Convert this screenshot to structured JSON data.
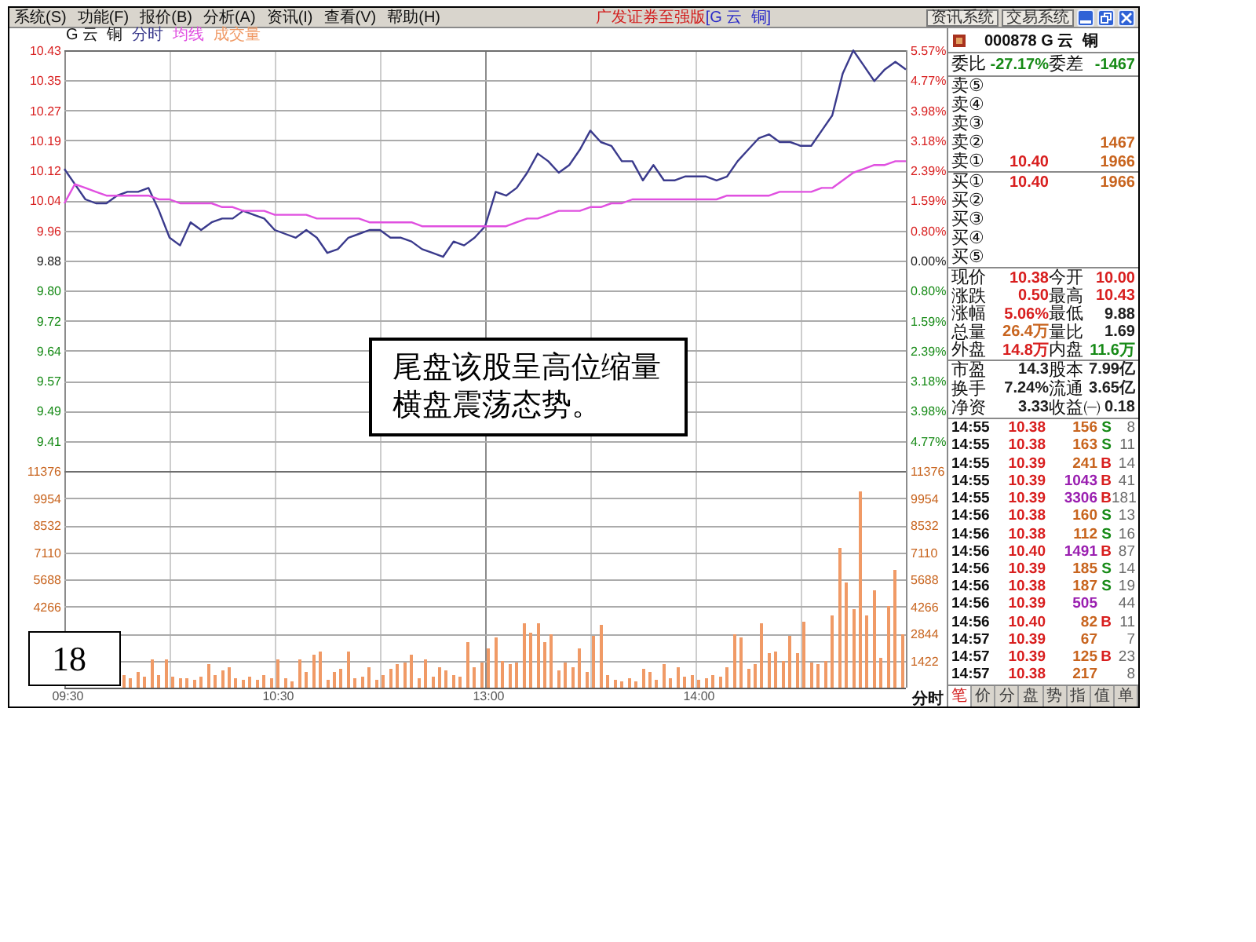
{
  "menu_bar": {
    "items": [
      "系统(S)",
      "功能(F)",
      "报价(B)",
      "分析(A)",
      "资讯(I)",
      "查看(V)",
      "帮助(H)"
    ],
    "app_title": "广发证券至强版",
    "stock_title": "[G 云  铜]",
    "system_buttons": [
      "资讯系统",
      "交易系统"
    ]
  },
  "price_chart": {
    "chart_data": {
      "type": "line",
      "title": "G 云  铜",
      "grid": true,
      "ylim": [
        9.4083,
        10.4303
      ],
      "yticks": [
        {
          "value": 10.4303,
          "label": "10.43"
        },
        {
          "value": 10.3517,
          "label": "10.35"
        },
        {
          "value": 10.2731,
          "label": "10.27"
        },
        {
          "value": 10.1945,
          "label": "10.19"
        },
        {
          "value": 10.1159,
          "label": "10.12"
        },
        {
          "value": 10.0372,
          "label": "10.04"
        },
        {
          "value": 9.9586,
          "label": "9.96"
        },
        {
          "value": 9.88,
          "label": "9.88"
        },
        {
          "value": 9.8014,
          "label": "9.80"
        },
        {
          "value": 9.7228,
          "label": "9.72"
        },
        {
          "value": 9.6441,
          "label": "9.64"
        },
        {
          "value": 9.5655,
          "label": "9.57"
        },
        {
          "value": 9.4869,
          "label": "9.49"
        },
        {
          "value": 9.4083,
          "label": "9.41"
        }
      ],
      "series": [
        {
          "name": "分时",
          "color": "#3a3a8c",
          "values": [
            10.12,
            10.08,
            10.04,
            10.03,
            10.03,
            10.05,
            10.06,
            10.06,
            10.07,
            10.01,
            9.94,
            9.92,
            9.98,
            9.96,
            9.98,
            9.99,
            9.99,
            10.01,
            10.0,
            9.99,
            9.96,
            9.95,
            9.94,
            9.96,
            9.94,
            9.9,
            9.91,
            9.94,
            9.95,
            9.96,
            9.96,
            9.94,
            9.94,
            9.93,
            9.91,
            9.9,
            9.89,
            9.93,
            9.92,
            9.94,
            9.97,
            10.06,
            10.05,
            10.07,
            10.11,
            10.16,
            10.14,
            10.11,
            10.13,
            10.17,
            10.22,
            10.19,
            10.18,
            10.14,
            10.14,
            10.09,
            10.13,
            10.09,
            10.09,
            10.1,
            10.1,
            10.1,
            10.09,
            10.1,
            10.14,
            10.17,
            10.2,
            10.21,
            10.19,
            10.19,
            10.18,
            10.18,
            10.22,
            10.26,
            10.37,
            10.43,
            10.39,
            10.35,
            10.38,
            10.4,
            10.38
          ]
        },
        {
          "name": "均线",
          "color": "#e050e0",
          "values": [
            10.03,
            10.08,
            10.07,
            10.06,
            10.05,
            10.05,
            10.05,
            10.05,
            10.05,
            10.04,
            10.04,
            10.03,
            10.03,
            10.03,
            10.03,
            10.02,
            10.02,
            10.01,
            10.01,
            10.01,
            10.0,
            10.0,
            10.0,
            10.0,
            9.99,
            9.99,
            9.99,
            9.99,
            9.99,
            9.98,
            9.98,
            9.98,
            9.98,
            9.98,
            9.97,
            9.97,
            9.97,
            9.97,
            9.97,
            9.97,
            9.97,
            9.97,
            9.97,
            9.98,
            9.99,
            9.99,
            10.0,
            10.01,
            10.01,
            10.01,
            10.02,
            10.02,
            10.03,
            10.03,
            10.04,
            10.04,
            10.04,
            10.04,
            10.04,
            10.04,
            10.04,
            10.04,
            10.04,
            10.05,
            10.05,
            10.05,
            10.05,
            10.05,
            10.06,
            10.06,
            10.06,
            10.06,
            10.07,
            10.07,
            10.09,
            10.11,
            10.12,
            10.13,
            10.13,
            10.14,
            10.14
          ]
        }
      ]
    },
    "percent_labels": [
      "5.57%",
      "4.77%",
      "3.98%",
      "3.18%",
      "2.39%",
      "1.59%",
      "0.80%",
      "0.00%",
      "0.80%",
      "1.59%",
      "2.39%",
      "3.18%",
      "3.98%",
      "4.77%"
    ]
  },
  "volume_chart": {
    "chart_data": {
      "type": "bar",
      "grid": true,
      "categories": [
        "09:30",
        null,
        null,
        null,
        null,
        null,
        null,
        null,
        null,
        null,
        null,
        null,
        null,
        null,
        null,
        null,
        null,
        null,
        null,
        null,
        null,
        null,
        null,
        null,
        null,
        null,
        null,
        null,
        null,
        null,
        "10:30",
        null,
        null,
        null,
        null,
        null,
        null,
        null,
        null,
        null,
        null,
        null,
        null,
        null,
        null,
        null,
        null,
        null,
        null,
        null,
        null,
        null,
        null,
        null,
        null,
        null,
        null,
        null,
        null,
        null,
        "13:00",
        null,
        null,
        null,
        null,
        null,
        null,
        null,
        null,
        null,
        null,
        null,
        null,
        null,
        null,
        null,
        null,
        null,
        null,
        null,
        null,
        null,
        null,
        null,
        null,
        null,
        null,
        null,
        null,
        null,
        "14:00",
        null,
        null,
        null,
        null,
        null,
        null,
        null,
        null,
        null,
        null,
        null,
        null,
        null,
        null,
        null,
        null,
        null,
        null,
        null,
        null,
        null,
        null,
        null,
        null,
        null,
        null,
        null,
        null,
        null
      ],
      "ylim": [
        0,
        11376
      ],
      "yticks": [
        1422,
        2844,
        4266,
        5688,
        7110,
        8532,
        9954,
        11376
      ],
      "series": [
        {
          "name": "成交量",
          "color": "#f09a66",
          "values": [
            null,
            null,
            null,
            null,
            null,
            null,
            null,
            null,
            700,
            500,
            800,
            600,
            1500,
            700,
            1500,
            600,
            500,
            500,
            400,
            600,
            1200,
            700,
            900,
            1100,
            500,
            400,
            600,
            400,
            700,
            500,
            1500,
            500,
            300,
            1500,
            800,
            1700,
            1900,
            400,
            800,
            1000,
            1900,
            500,
            600,
            1100,
            400,
            700,
            1000,
            1200,
            1300,
            1700,
            500,
            1500,
            600,
            1100,
            900,
            700,
            600,
            2400,
            1100,
            1300,
            2100,
            2600,
            1400,
            1200,
            1300,
            3400,
            2900,
            3400,
            2400,
            2800,
            900,
            1300,
            1100,
            2100,
            800,
            2700,
            3300,
            700,
            400,
            300,
            500,
            300,
            1000,
            800,
            400,
            1200,
            500,
            1100,
            600,
            700,
            400,
            500,
            700,
            600,
            1100,
            2800,
            2600,
            1000,
            1200,
            3400,
            1800,
            1900,
            1400,
            2700,
            1800,
            3500,
            1300,
            1200,
            1400,
            3800,
            7300,
            5500,
            4100,
            10300,
            3800,
            5100,
            1600,
            4300,
            6200,
            2800
          ]
        }
      ]
    },
    "left_labels": [
      "11376",
      "9954",
      "8532",
      "7110",
      "5688",
      "4266"
    ],
    "period_label": "分时"
  },
  "annotation": "尾盘该股呈高位缩量横盘震荡态势。",
  "page_number": "18",
  "quote_panel": {
    "header": "000878 G 云  铜",
    "order_stats": [
      {
        "label": "委比",
        "value": "-27.17%",
        "color": "#168a16"
      },
      {
        "label": "委差",
        "value": "-1467",
        "color": "#168a16"
      }
    ],
    "asks": [
      {
        "label": "卖⑤"
      },
      {
        "label": "卖④"
      },
      {
        "label": "卖③"
      },
      {
        "label": "卖②",
        "volume": "1467"
      },
      {
        "label": "卖①",
        "price": "10.40",
        "volume": "1966"
      }
    ],
    "bids": [
      {
        "label": "买①",
        "price": "10.40",
        "volume": "1966"
      },
      {
        "label": "买②"
      },
      {
        "label": "买③"
      },
      {
        "label": "买④"
      },
      {
        "label": "买⑤"
      }
    ],
    "quotes": [
      {
        "label": "现价",
        "value": "10.38",
        "color": "#d81e1e"
      },
      {
        "label": "今开",
        "value": "10.00",
        "color": "#d81e1e"
      },
      {
        "label": "涨跌",
        "value": "0.50",
        "color": "#d81e1e"
      },
      {
        "label": "最高",
        "value": "10.43",
        "color": "#d81e1e"
      },
      {
        "label": "涨幅",
        "value": "5.06%",
        "color": "#d81e1e"
      },
      {
        "label": "最低",
        "value": "9.88",
        "color": "#202020"
      },
      {
        "label": "总量",
        "value": "26.4万",
        "color": "#c8641e"
      },
      {
        "label": "量比",
        "value": "1.69",
        "color": "#202020"
      },
      {
        "label": "外盘",
        "value": "14.8万",
        "color": "#d81e1e"
      },
      {
        "label": "内盘",
        "value": "11.6万",
        "color": "#168a16"
      }
    ],
    "fundamentals": [
      {
        "label": "市盈",
        "value": "14.3"
      },
      {
        "label": "股本",
        "value": "7.99亿"
      },
      {
        "label": "换手",
        "value": "7.24%"
      },
      {
        "label": "流通",
        "value": "3.65亿"
      },
      {
        "label": "净资",
        "value": "3.33"
      },
      {
        "label": "收益㈠",
        "value": "0.18"
      }
    ],
    "trades": [
      {
        "time": "14:55",
        "price": "10.38",
        "volume": "156",
        "large": false,
        "kind": "sell",
        "side": "S",
        "count": "8"
      },
      {
        "time": "14:55",
        "price": "10.38",
        "volume": "163",
        "large": false,
        "kind": "sell",
        "side": "S",
        "count": "11"
      },
      {
        "time": "14:55",
        "price": "10.39",
        "volume": "241",
        "large": false,
        "kind": "buy",
        "side": "B",
        "count": "14"
      },
      {
        "time": "14:55",
        "price": "10.39",
        "volume": "1043",
        "large": true,
        "kind": "buy",
        "side": "B",
        "count": "41"
      },
      {
        "time": "14:55",
        "price": "10.39",
        "volume": "3306",
        "large": true,
        "kind": "buy",
        "side": "B",
        "count": "181"
      },
      {
        "time": "14:56",
        "price": "10.38",
        "volume": "160",
        "large": false,
        "kind": "sell",
        "side": "S",
        "count": "13"
      },
      {
        "time": "14:56",
        "price": "10.38",
        "volume": "112",
        "large": false,
        "kind": "sell",
        "side": "S",
        "count": "16"
      },
      {
        "time": "14:56",
        "price": "10.40",
        "volume": "1491",
        "large": true,
        "kind": "buy",
        "side": "B",
        "count": "87"
      },
      {
        "time": "14:56",
        "price": "10.39",
        "volume": "185",
        "large": false,
        "kind": "sell",
        "side": "S",
        "count": "14"
      },
      {
        "time": "14:56",
        "price": "10.38",
        "volume": "187",
        "large": false,
        "kind": "sell",
        "side": "S",
        "count": "19"
      },
      {
        "time": "14:56",
        "price": "10.39",
        "volume": "505",
        "large": true,
        "kind": "neutral",
        "count": "44"
      },
      {
        "time": "14:56",
        "price": "10.40",
        "volume": "82",
        "large": false,
        "kind": "buy",
        "side": "B",
        "count": "11"
      },
      {
        "time": "14:57",
        "price": "10.39",
        "volume": "67",
        "large": false,
        "kind": "neutral",
        "count": "7"
      },
      {
        "time": "14:57",
        "price": "10.39",
        "volume": "125",
        "large": false,
        "kind": "buy",
        "side": "B",
        "count": "23"
      },
      {
        "time": "14:57",
        "price": "10.38",
        "volume": "217",
        "large": false,
        "kind": "neutral",
        "count": "8"
      }
    ],
    "tabs": [
      {
        "label": "笔",
        "selected": true
      },
      {
        "label": "价",
        "selected": false
      },
      {
        "label": "分",
        "selected": false
      },
      {
        "label": "盘",
        "selected": false
      },
      {
        "label": "势",
        "selected": false
      },
      {
        "label": "指",
        "selected": false
      },
      {
        "label": "值",
        "selected": false
      },
      {
        "label": "单",
        "selected": false
      }
    ]
  }
}
